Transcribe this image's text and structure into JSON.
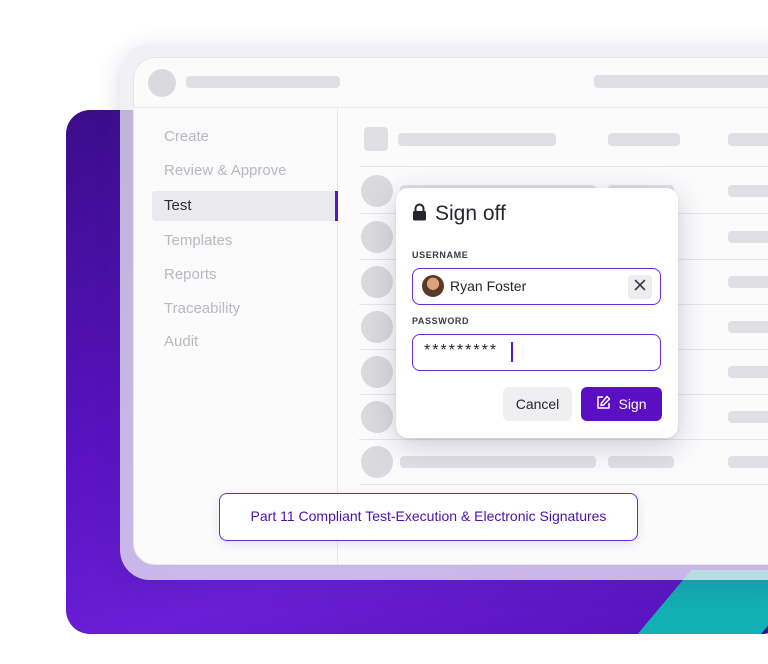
{
  "nav": {
    "items": [
      {
        "label": "Create",
        "active": false
      },
      {
        "label": "Review & Approve",
        "active": false
      },
      {
        "label": "Test",
        "active": true
      },
      {
        "label": "Templates",
        "active": false
      },
      {
        "label": "Reports",
        "active": false
      },
      {
        "label": "Traceability",
        "active": false
      },
      {
        "label": "Audit",
        "active": false
      }
    ]
  },
  "dialog": {
    "title": "Sign off",
    "icon": "lock-icon",
    "username_label": "USERNAME",
    "username_value": "Ryan Foster",
    "password_label": "PASSWORD",
    "password_value": "*********",
    "cancel_label": "Cancel",
    "sign_label": "Sign"
  },
  "caption": "Part 11 Compliant Test-Execution & Electronic Signatures",
  "colors": {
    "accent": "#5a0fc2",
    "teal": "#12b0b2",
    "backdrop": "#5a12c2"
  }
}
